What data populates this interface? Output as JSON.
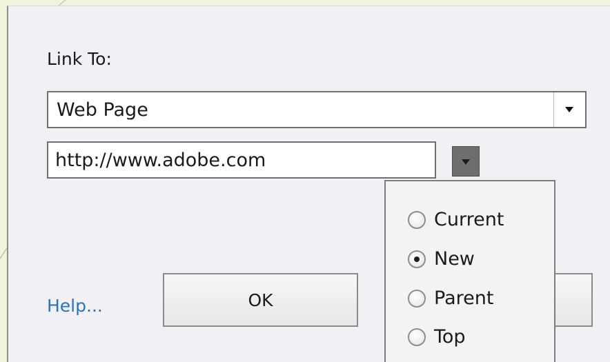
{
  "dialog": {
    "link_to_label": "Link To:",
    "link_type": {
      "selected": "Web Page"
    },
    "url_input": {
      "value": "http://www.adobe.com"
    },
    "target_menu": {
      "options": [
        {
          "label": "Current",
          "checked": false
        },
        {
          "label": "New",
          "checked": true
        },
        {
          "label": "Parent",
          "checked": false
        },
        {
          "label": "Top",
          "checked": false
        }
      ]
    },
    "buttons": {
      "help_label": "Help...",
      "ok_label": "OK"
    }
  },
  "colors": {
    "outer_background": "#f1f3da",
    "dialog_background": "#f0f0f5",
    "help_link": "#2a74b8",
    "toggle_button": "#6e6e6e"
  },
  "icons": [
    "chevron-down-icon",
    "radio-icon"
  ]
}
